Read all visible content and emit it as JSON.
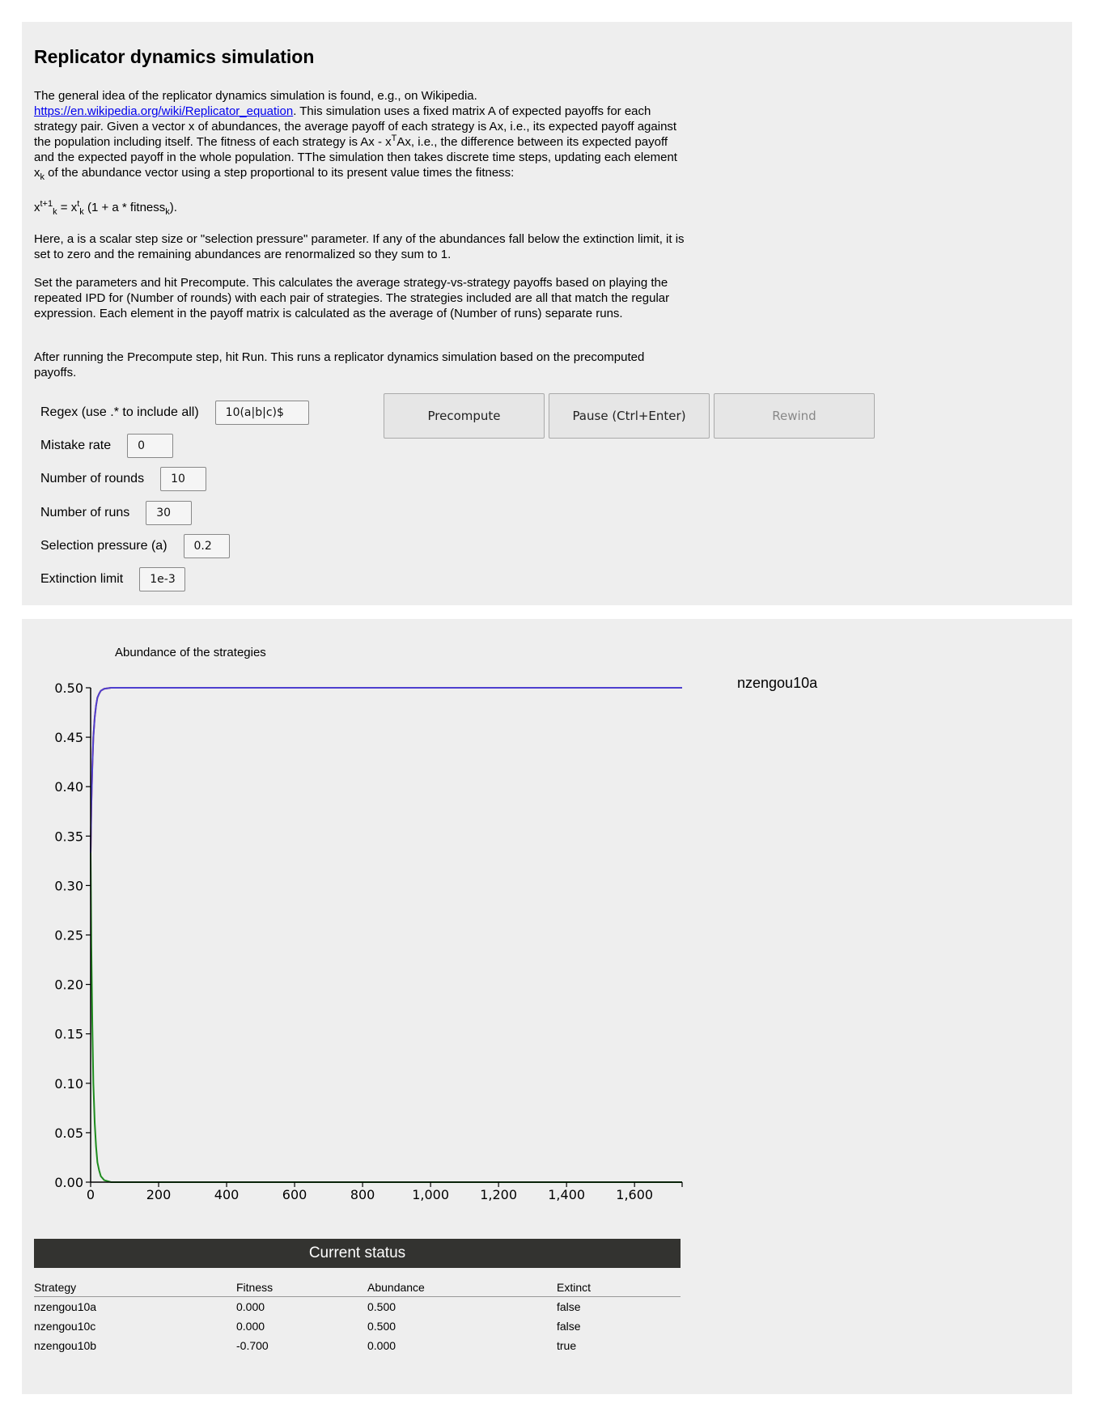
{
  "page": {
    "title": "Replicator dynamics simulation",
    "intro": {
      "p1_text": "The general idea of the replicator dynamics simulation is found, e.g., on Wikipedia. ",
      "p1_link": "https://en.wikipedia.org/wiki/Replicator_equation",
      "p1_rest_a": ". This simulation uses a fixed matrix A of expected payoffs for each strategy pair. Given a vector x of abundances, the average payoff of each strategy is Ax, i.e., its expected payoff against the population including itself. The fitness of each strategy is Ax - x",
      "p1_sup_T": "T",
      "p1_rest_b": "Ax, i.e., the difference between its expected payoff and the expected payoff in the whole population. TThe simulation then takes discrete time steps, updating each element x",
      "p1_sub_k": "k",
      "p1_rest_c": " of the abundance vector using a step proportional to its present value times the fitness:"
    },
    "formula": {
      "x1": "x",
      "sup1": "t+1",
      "sub1": "k",
      "eq": " = x",
      "sup2": "t",
      "sub2": "k",
      "mid": " (1 + a * fitness",
      "sub3": "k",
      "end": ")."
    },
    "p2": "Here, a is a scalar step size or \"selection pressure\" parameter. If any of the abundances fall below the extinction limit, it is set to zero and the remaining abundances are renormalized so they sum to 1.",
    "p3": "Set the parameters and hit Precompute. This calculates the average strategy-vs-strategy payoffs based on playing the repeated IPD for (Number of rounds) with each pair of strategies. The strategies included are all that match the regular expression. Each element in the payoff matrix is calculated as the average of (Number of runs) separate runs.",
    "p4": "After running the Precompute step, hit Run. This runs a replicator dynamics simulation based on the precomputed payoffs."
  },
  "params": {
    "regex": {
      "label": "Regex (use .* to include all)",
      "value": "10(a|b|c)$"
    },
    "mistake_rate": {
      "label": "Mistake rate",
      "value": "0"
    },
    "rounds": {
      "label": "Number of rounds",
      "value": "10"
    },
    "runs": {
      "label": "Number of runs",
      "value": "30"
    },
    "selection_pressure": {
      "label": "Selection pressure (a)",
      "value": "0.2"
    },
    "extinction_limit": {
      "label": "Extinction limit",
      "value": "1e-3"
    }
  },
  "buttons": {
    "precompute": "Precompute",
    "pause": "Pause (Ctrl+Enter)",
    "rewind": "Rewind"
  },
  "chart_data": {
    "type": "line",
    "title": "Abundance of the strategies",
    "xlim": [
      0,
      1740
    ],
    "ylim": [
      0,
      0.5
    ],
    "x_ticks": [
      0,
      200,
      400,
      600,
      800,
      1000,
      1200,
      1400,
      1600
    ],
    "x_tick_labels": [
      "0",
      "200",
      "400",
      "600",
      "800",
      "1,000",
      "1,200",
      "1,400",
      "1,600"
    ],
    "y_ticks": [
      0,
      0.05,
      0.1,
      0.15,
      0.2,
      0.25,
      0.3,
      0.35,
      0.4,
      0.45,
      0.5
    ],
    "y_tick_labels": [
      "0.00",
      "0.05",
      "0.10",
      "0.15",
      "0.20",
      "0.25",
      "0.30",
      "0.35",
      "0.40",
      "0.45",
      "0.50"
    ],
    "legend_visible": [
      "nzengou10a"
    ],
    "legend_position": "top-right",
    "series": [
      {
        "name": "nzengou10a",
        "color": "#e04020",
        "x": [
          0,
          2,
          5,
          8,
          12,
          16,
          20,
          25,
          30,
          40,
          60,
          100,
          400,
          1740
        ],
        "y": [
          0.333,
          0.38,
          0.42,
          0.45,
          0.47,
          0.482,
          0.49,
          0.494,
          0.497,
          0.499,
          0.5,
          0.5,
          0.5,
          0.5
        ]
      },
      {
        "name": "nzengou10c",
        "color": "#4d3fcf",
        "x": [
          0,
          2,
          5,
          8,
          12,
          16,
          20,
          25,
          30,
          40,
          60,
          100,
          400,
          1740
        ],
        "y": [
          0.333,
          0.38,
          0.42,
          0.45,
          0.47,
          0.482,
          0.49,
          0.494,
          0.497,
          0.499,
          0.5,
          0.5,
          0.5,
          0.5
        ]
      },
      {
        "name": "nzengou10b",
        "color": "#1e8c1e",
        "x": [
          0,
          2,
          5,
          8,
          12,
          16,
          20,
          25,
          30,
          40,
          60,
          100,
          400,
          1740
        ],
        "y": [
          0.333,
          0.24,
          0.16,
          0.1,
          0.06,
          0.036,
          0.02,
          0.012,
          0.006,
          0.002,
          0,
          0,
          0,
          0
        ]
      }
    ]
  },
  "status": {
    "header": "Current status",
    "columns": [
      "Strategy",
      "Fitness",
      "Abundance",
      "Extinct"
    ],
    "rows": [
      [
        "nzengou10a",
        "0.000",
        "0.500",
        "false"
      ],
      [
        "nzengou10c",
        "0.000",
        "0.500",
        "false"
      ],
      [
        "nzengou10b",
        "-0.700",
        "0.000",
        "true"
      ]
    ]
  }
}
